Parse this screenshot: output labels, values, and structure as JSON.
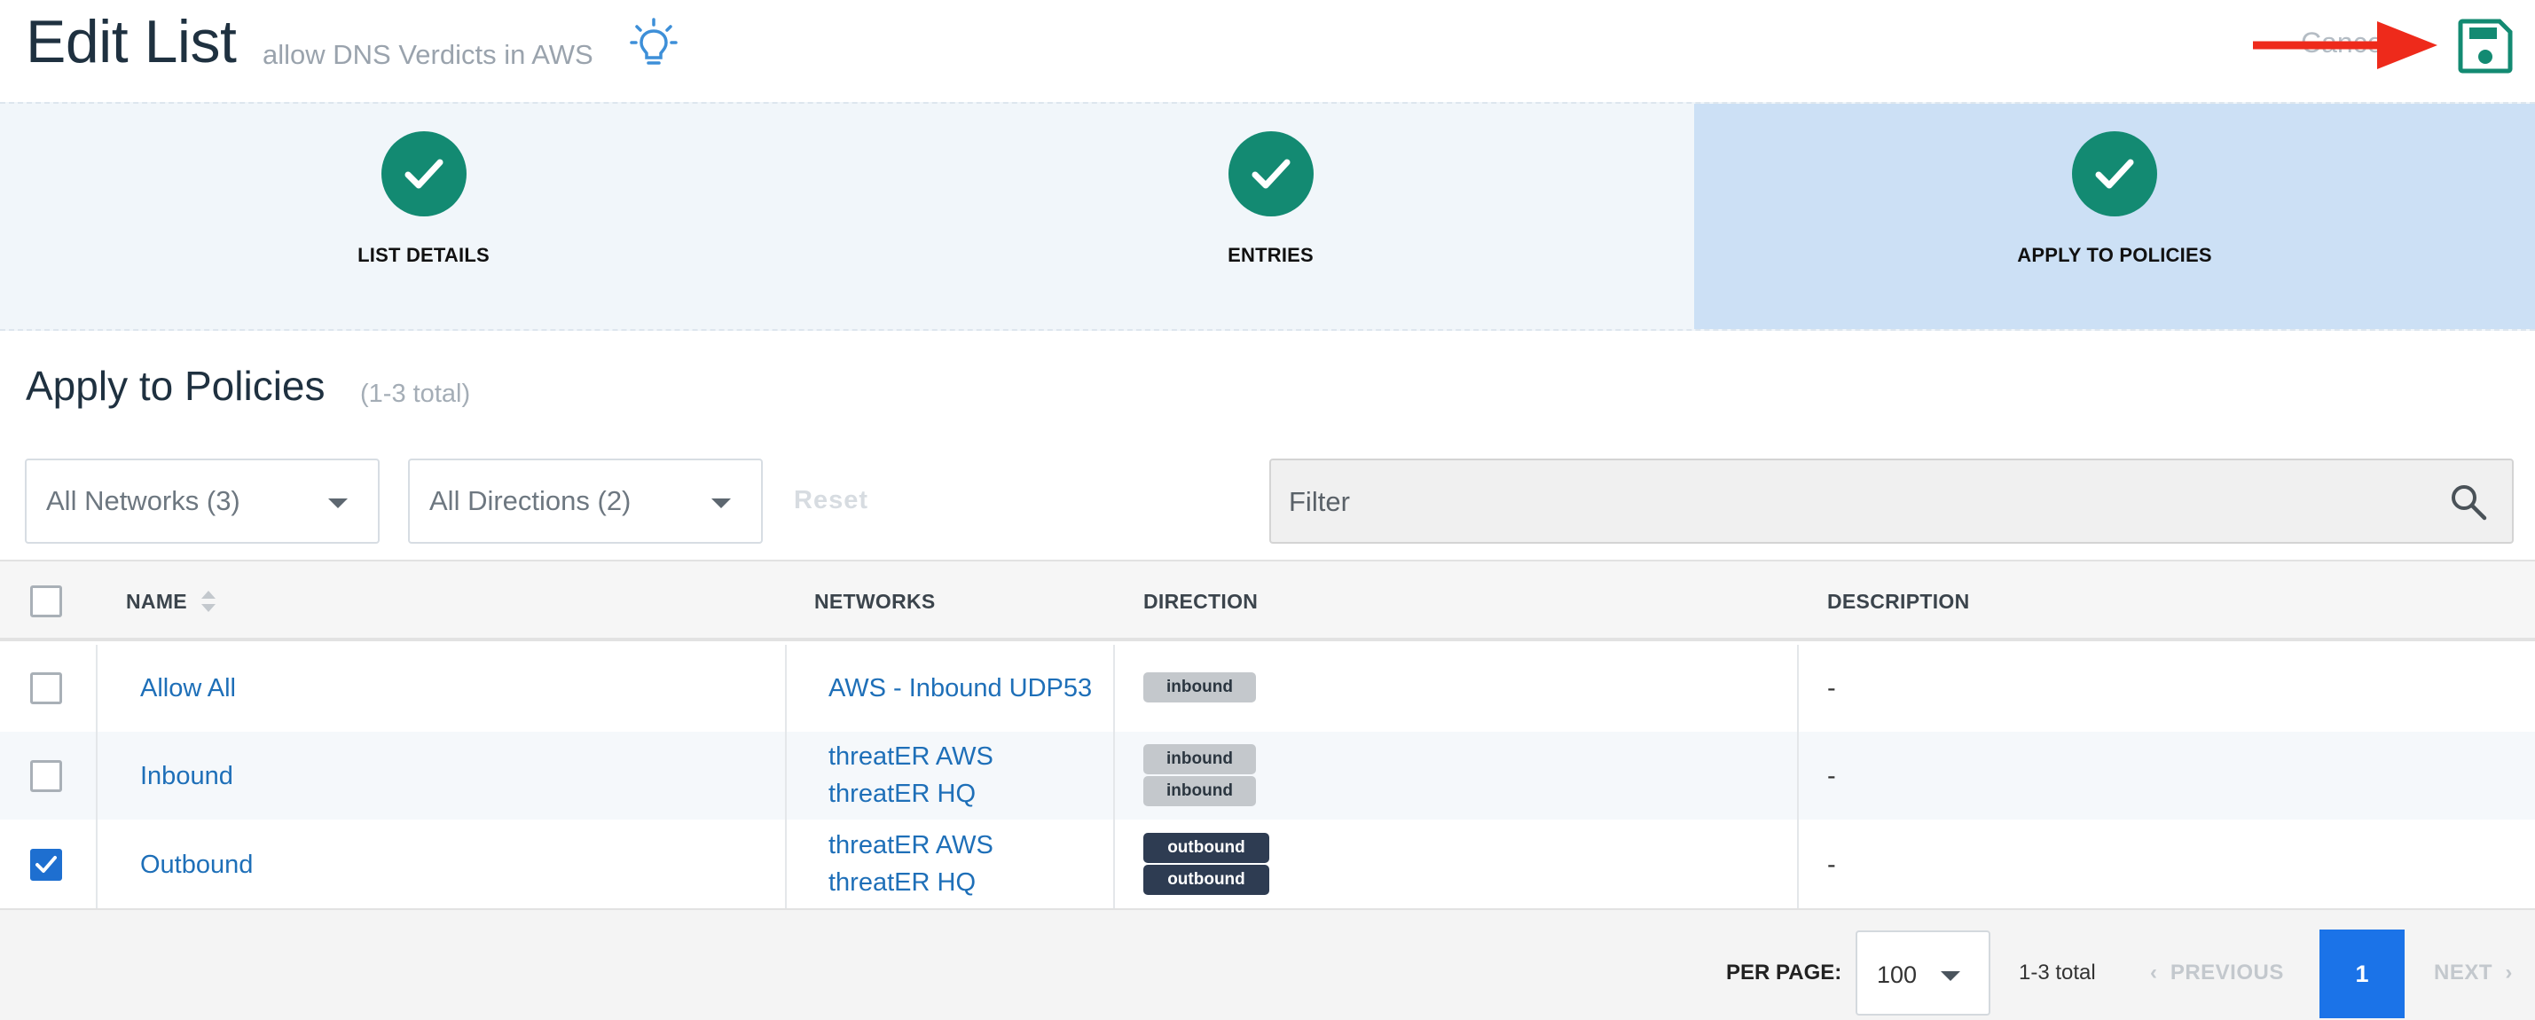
{
  "header": {
    "title": "Edit List",
    "subtitle": "allow DNS Verdicts in AWS",
    "cancel_label": "Cancel"
  },
  "stepper": {
    "steps": [
      {
        "label": "LIST DETAILS",
        "status": "complete"
      },
      {
        "label": "ENTRIES",
        "status": "complete"
      },
      {
        "label": "APPLY TO POLICIES",
        "status": "complete",
        "active": true
      }
    ]
  },
  "section": {
    "title": "Apply to Policies",
    "count": "(1-3 total)"
  },
  "filters": {
    "networks": "All Networks (3)",
    "directions": "All Directions (2)",
    "reset_label": "Reset",
    "search_placeholder": "Filter"
  },
  "table": {
    "columns": [
      "NAME",
      "NETWORKS",
      "DIRECTION",
      "DESCRIPTION"
    ],
    "rows": [
      {
        "name": "Allow All",
        "networks": [
          "AWS - Inbound UDP53"
        ],
        "directions": [
          "inbound"
        ],
        "description": "-",
        "checked": false
      },
      {
        "name": "Inbound",
        "networks": [
          "threatER AWS",
          "threatER HQ"
        ],
        "directions": [
          "inbound",
          "inbound"
        ],
        "description": "-",
        "checked": false
      },
      {
        "name": "Outbound",
        "networks": [
          "threatER AWS",
          "threatER HQ"
        ],
        "directions": [
          "outbound",
          "outbound"
        ],
        "description": "-",
        "checked": true
      }
    ]
  },
  "pagination": {
    "per_page_label": "PER PAGE:",
    "per_page_value": "100",
    "total": "1-3 total",
    "previous_label": "PREVIOUS",
    "current_page": "1",
    "next_label": "NEXT"
  },
  "colors": {
    "step_complete": "#138a72",
    "step_active_bg": "#cce0f5",
    "link": "#1e6fb8",
    "page_active": "#1b73e8",
    "annotation_arrow": "#ee2a1b"
  }
}
